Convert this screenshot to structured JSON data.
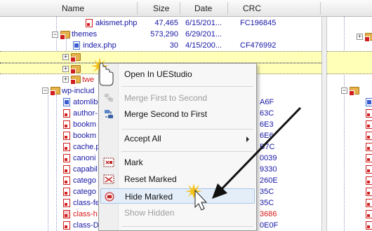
{
  "header": {
    "name": "Name",
    "size": "Size",
    "date": "Date",
    "crc": "CRC"
  },
  "rows": [
    {
      "name": "akismet.php",
      "size": "47,465",
      "date": "6/15/201...",
      "crc": "FC196845"
    },
    {
      "name": "themes",
      "size": "573,290",
      "date": "6/29/201...",
      "crc": ""
    },
    {
      "name": "index.php",
      "size": "30",
      "date": "4/15/200...",
      "crc": "CF476992"
    },
    {
      "name": "twe",
      "size": "",
      "date": "",
      "crc": ""
    },
    {
      "name": "wp-includ",
      "size": "",
      "date": "",
      "crc": ""
    },
    {
      "name": "atomlib",
      "crc": "A6F"
    },
    {
      "name": "author-",
      "crc": "63C"
    },
    {
      "name": "bookm",
      "crc": "6E3"
    },
    {
      "name": "bookm",
      "crc": "6E6"
    },
    {
      "name": "cache.p",
      "crc": "B7C"
    },
    {
      "name": "canoni",
      "crc": "0039"
    },
    {
      "name": "capabil",
      "crc": "9330"
    },
    {
      "name": "catego",
      "crc": "260E"
    },
    {
      "name": "catego",
      "crc": "35C"
    },
    {
      "name": "class-fe",
      "crc": "35C"
    },
    {
      "name": "class-h",
      "crc": "3686"
    },
    {
      "name": "class-D",
      "crc": "0E0F"
    }
  ],
  "menu": {
    "open_in": "Open In UEStudio",
    "merge_first": "Merge First to Second",
    "merge_second": "Merge Second to First",
    "accept_all": "Accept All",
    "mark": "Mark",
    "reset_marked": "Reset Marked",
    "hide_marked": "Hide Marked",
    "show_hidden": "Show Hidden"
  },
  "colors": {
    "link_blue": "#1717a6",
    "red": "#d81818",
    "highlight": "#ffffb8",
    "menu_selected": "#e4eef9"
  },
  "icons": [
    "file-icon",
    "folder-icon",
    "expand-plus-icon",
    "merge-icon",
    "mark-icon",
    "hide-icon",
    "arrow-annotation",
    "mouse-cursor-icon"
  ]
}
